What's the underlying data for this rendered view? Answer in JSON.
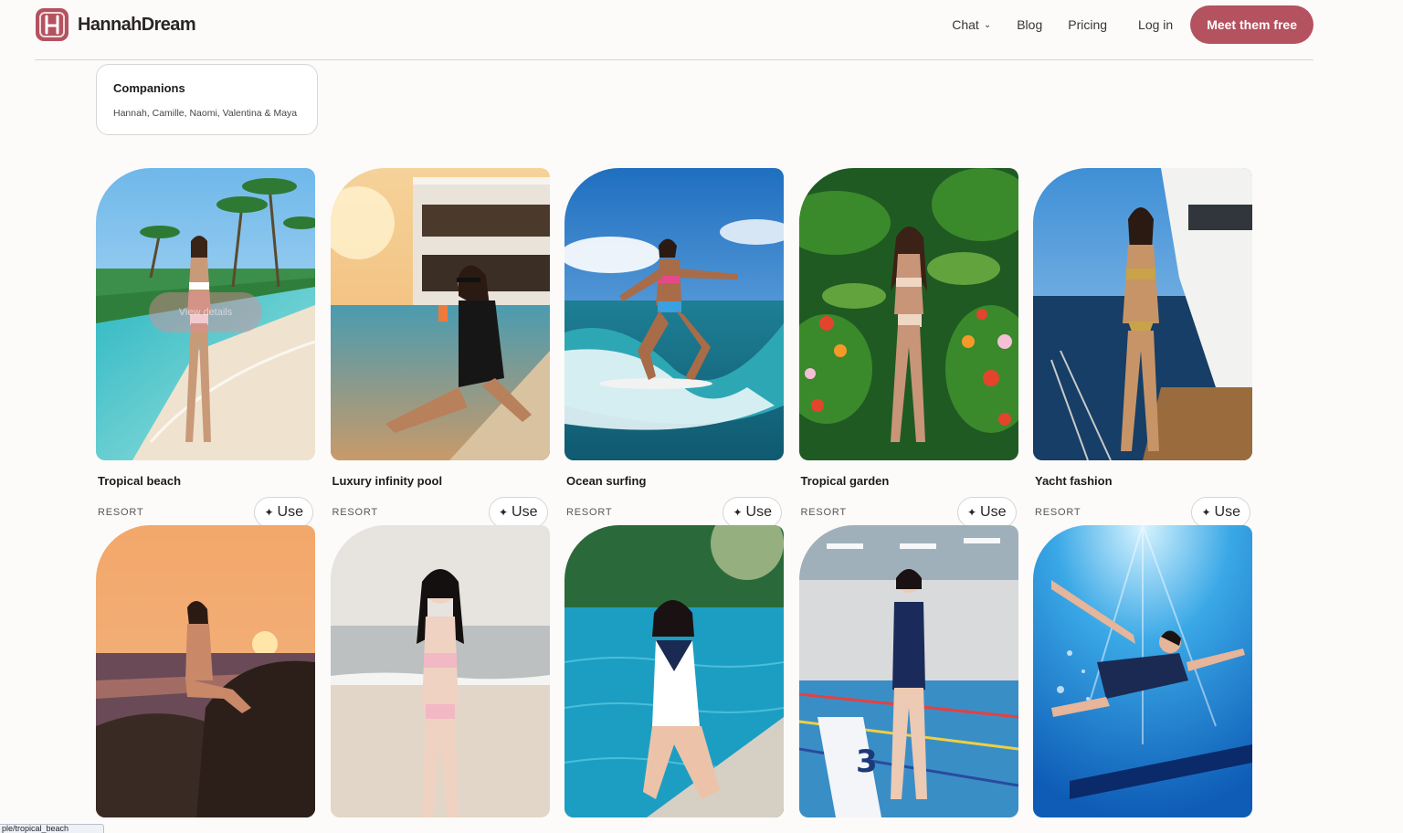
{
  "brand": {
    "name": "HannahDream",
    "logo_letter": "H"
  },
  "nav": {
    "chat": "Chat",
    "blog": "Blog",
    "pricing": "Pricing",
    "login": "Log in",
    "cta": "Meet them free"
  },
  "companions": {
    "title": "Companions",
    "names": "Hannah, Camille, Naomi, Valentina & Maya"
  },
  "use_label": "Use",
  "hover_label": "View details",
  "status_url": "ple/tropical_beach",
  "cards": [
    {
      "title": "Tropical beach",
      "tag": "RESORT"
    },
    {
      "title": "Luxury infinity pool",
      "tag": "RESORT"
    },
    {
      "title": "Ocean surfing",
      "tag": "RESORT"
    },
    {
      "title": "Tropical garden",
      "tag": "RESORT"
    },
    {
      "title": "Yacht fashion",
      "tag": "RESORT"
    },
    {
      "title": "",
      "tag": ""
    },
    {
      "title": "",
      "tag": ""
    },
    {
      "title": "",
      "tag": ""
    },
    {
      "title": "",
      "tag": ""
    },
    {
      "title": "",
      "tag": ""
    }
  ],
  "colors": {
    "accent": "#b4525f",
    "background": "#fcfbfa"
  }
}
